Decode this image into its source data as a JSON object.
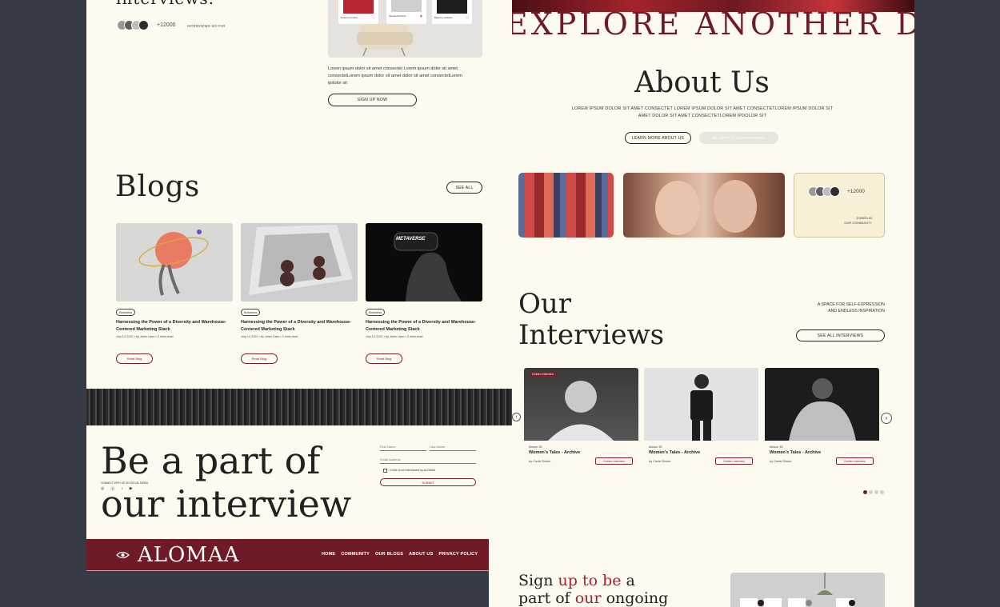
{
  "hero": {
    "heading_fragment": "interviews.",
    "count": "+12000",
    "count_caption": "INTERVIEWS SO FAR",
    "description": "Lorem ipsum dolor sit amet consectet Lorem ipsum dolor sit amet consectetLorem ipsum dolor sit amet dolor sit amet consectetLorem ipdolor sit",
    "signup_label": "SIGN UP NOW",
    "mini_card_names": [
      "Dolores Umbria",
      "Alexandra Paris",
      "Bethany Jackson"
    ]
  },
  "banner": {
    "text": "EXPLORE ANOTHER DIM"
  },
  "about": {
    "title": "About Us",
    "text": "LOREM IPSUM DOLOR SIT AMET CONSECTET LOREM IPSUM DOLOR SIT AMET CONSECTETLOREM IPSUM DOLOR SIT AMET  DOLOR SIT AMET CONSECTETLOREM IPDOLOR SIT",
    "learn_more_label": "LEARN MORE ABOUT US",
    "secondary_label": "BE A PART OF OUR INTERVIEWS",
    "community_count": "+12000",
    "community_caption_1": "JOINED IN",
    "community_caption_2": "OUR COMMUNITY"
  },
  "blogs": {
    "title": "Blogs",
    "see_all_label": "SEE ALL",
    "items": [
      {
        "tag": "Business",
        "title": "Harnessing the Power of a Diversity and Warehouse-Centered Marketing Stack",
        "meta": "July 14 2022  •  by Jules Liam  •  3 mins read",
        "read_label": "Read Blog"
      },
      {
        "tag": "Business",
        "title": "Harnessing the Power of a Diversity and Warehouse-Centered Marketing Stack",
        "meta": "July 14 2022  •  by Jules Liam  •  3 mins read",
        "read_label": "Read Blog"
      },
      {
        "tag": "Business",
        "title": "Harnessing the Power of a Diversity and Warehouse-Centered Marketing Stack",
        "meta": "July 14 2022  •  by Jules Liam  •  3 mins read",
        "read_label": "Read Blog"
      }
    ],
    "vr_caption": "METAVERSE"
  },
  "interviews": {
    "title_line1": "Our",
    "title_line2": "Interviews",
    "tagline_line1": "A SPACE FOR SELF-EXPRESSION",
    "tagline_line2": "AND ENDLESS INSPIRATION",
    "see_all_label": "SEE ALL INTERVIEWS",
    "items": [
      {
        "badge_top": "Golden Interview",
        "issue": "#Issue 35",
        "title": "Women's Tales - Archive",
        "author": "by Carla Simón",
        "badge": "Golden Interview"
      },
      {
        "badge_top": "",
        "issue": "#Issue 35",
        "title": "Women's Tales - Archive",
        "author": "by Carla Simón",
        "badge": "Golden Interview"
      },
      {
        "badge_top": "",
        "issue": "#Issue 35",
        "title": "Women's Tales - Archive",
        "author": "by Carla Simón",
        "badge": "Golden Interview"
      }
    ],
    "prev_icon": "chevron-left-icon",
    "next_icon": "chevron-right-icon"
  },
  "join": {
    "title_line1": "Be a part of",
    "title_line2": "our interview",
    "social_caption": "CONNECT WITH US ON SOCIAL MEDIA",
    "first_name_placeholder": "First Name",
    "last_name_placeholder": "Last Name",
    "email_placeholder": "Email Address",
    "checkbox_label": "I'd like to be interviewed by ALOMAA",
    "submit_label": "SUBMIT"
  },
  "footer": {
    "brand": "ALOMAA",
    "nav": [
      "HOME",
      "COMMUNITY",
      "OUR BLOGS",
      "ABOUT US",
      "PRIVACY POLICY"
    ]
  },
  "signup": {
    "line1_a": "Sign ",
    "line1_b": "up to be",
    "line1_c": " a",
    "line2_a": "part of ",
    "line2_b": "our",
    "line2_c": " ongoing"
  },
  "colors": {
    "cream": "#fdfaf0",
    "maroon": "#6e1b26",
    "dark_bg": "#363a45",
    "accent_red": "#c0392b"
  }
}
